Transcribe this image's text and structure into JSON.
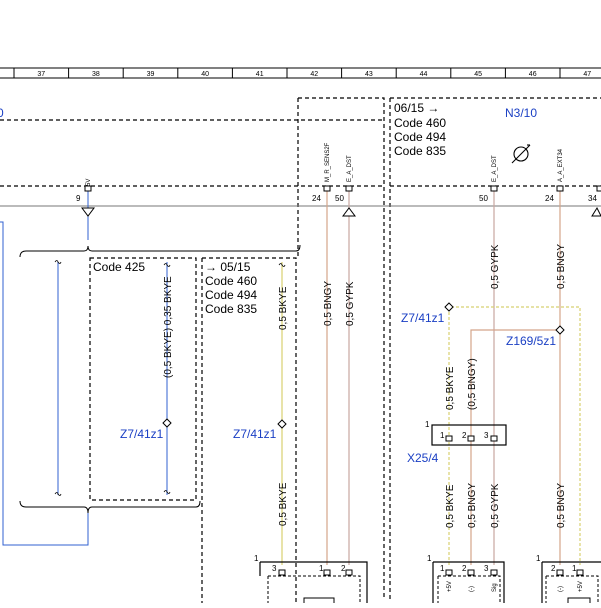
{
  "ruler": {
    "columns": [
      "37",
      "38",
      "39",
      "40",
      "41",
      "42",
      "43",
      "44",
      "45",
      "46",
      "47"
    ]
  },
  "blocks": {
    "left_partial_label": "0",
    "n310": {
      "date_note": "06/15 →",
      "codes": [
        "Code 460",
        "Code 494",
        "Code 835"
      ],
      "component_id": "N3/10"
    },
    "code425": {
      "label": "Code 425"
    },
    "second_block": {
      "date_note": "→ 05/15",
      "codes": [
        "Code 460",
        "Code 494",
        "Code 835"
      ]
    }
  },
  "pins": {
    "pin_9": "9",
    "pin_24a": "24",
    "pin_50a": "50",
    "pin_50b": "50",
    "pin_24b": "24",
    "pin_34": "34"
  },
  "signals": {
    "s5v": "5V",
    "m_r_sens2f": "M_R_SENS2F",
    "e_a_dst_1": "E_A_DST",
    "e_a_dst_2": "E_A_DST",
    "a_a_ext34": "A_A_EXT34"
  },
  "wires": {
    "w_bkye_1": "0,5 BKYE",
    "w_bkye_paren": "(0,5 BKYE) 0,35 BKYE",
    "w_bkye_2": "0,5 BKYE",
    "w_bkye_3": "0,5 BKYE",
    "w_bngy_1": "0,5 BNGY",
    "w_gypk_1": "0,5 GYPK",
    "w_gypk_2": "0,5 GYPK",
    "w_bngy_2": "0,5 BNGY",
    "w_bkye_4": "0,5 BKYE",
    "w_bngy_paren": "(0,5 BNGY)",
    "w_bkye_5": "0,5 BKYE",
    "w_bngy_3": "0,5 BNGY",
    "w_gypk_3": "0,5 GYPK",
    "w_bngy_4": "0,5 BNGY"
  },
  "splices": {
    "z7_41z1_a": "Z7/41z1",
    "z7_41z1_b": "Z7/41z1",
    "z7_41z1_c": "Z7/41z1",
    "z169_5z1": "Z169/5z1"
  },
  "connectors": {
    "x25_4": "X25/4",
    "x25_pin_outer": "1",
    "x25_pins": [
      "1",
      "2",
      "3"
    ]
  },
  "bottom": {
    "conn_a_outer": "1",
    "conn_a_pins": [
      "3",
      "1",
      "2"
    ],
    "conn_b_outer": "1",
    "conn_b_pins": [
      "1",
      "2",
      "3"
    ],
    "conn_b_sub": [
      "+5V",
      "(-)",
      "Sig"
    ],
    "conn_c_outer": "1",
    "conn_c_pins": [
      "2",
      "1"
    ],
    "conn_c_sub": [
      "(-)",
      "+5V"
    ]
  },
  "colors": {
    "ink": "#000000",
    "label_blue": "#1a3fc4",
    "bkye": "#d8d070",
    "bngy": "#d4a58a",
    "gypk": "#c9a7a0",
    "blue_wire": "#3060d0"
  }
}
